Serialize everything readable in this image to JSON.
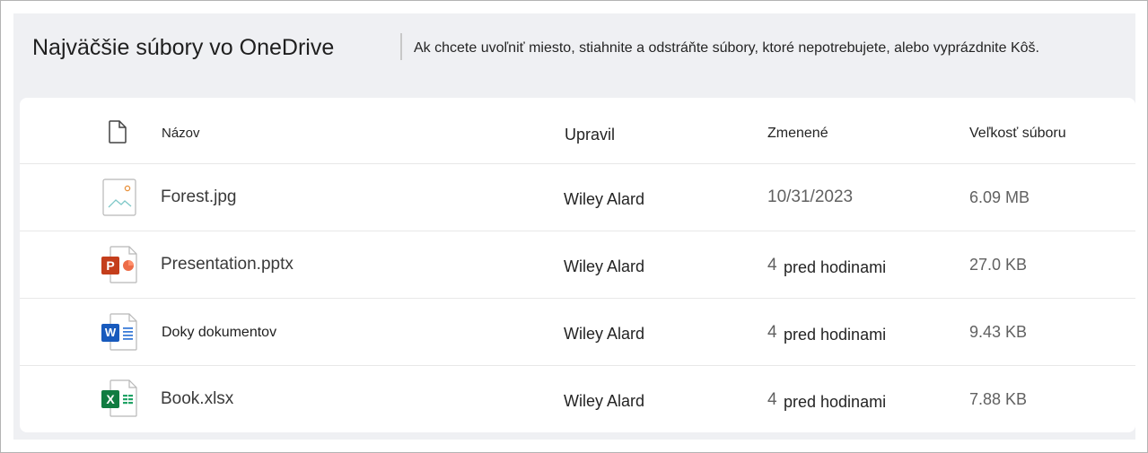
{
  "header": {
    "title": "Najväčšie súbory vo OneDrive",
    "description": "Ak chcete uvoľniť miesto, stiahnite a odstráňte súbory, ktoré nepotrebujete, alebo vyprázdnite Kôš."
  },
  "table": {
    "columns": {
      "name": "Názov",
      "modified_by": "Upravil",
      "modified": "Zmenené",
      "size": "Veľkosť súboru"
    },
    "rows": [
      {
        "icon": "image-file-icon",
        "name": "Forest.jpg",
        "modified_by": "Wiley Alard",
        "modified": "10/31/2023",
        "size": "6.09 MB"
      },
      {
        "icon": "powerpoint-file-icon",
        "badge": "P",
        "name": "Presentation.pptx",
        "modified_by": "Wiley Alard",
        "modified_num": "4",
        "modified_text": "pred hodinami",
        "size": "27.0 KB"
      },
      {
        "icon": "word-file-icon",
        "badge": "W",
        "name": "Doky dokumentov",
        "modified_by": "Wiley Alard",
        "modified_num": "4",
        "modified_text": "pred hodinami",
        "size": "9.43 KB"
      },
      {
        "icon": "excel-file-icon",
        "badge": "X",
        "name": "Book.xlsx",
        "modified_by": "Wiley Alard",
        "modified_num": "4",
        "modified_text": "pred hodinami",
        "size": "7.88 KB"
      }
    ]
  },
  "colors": {
    "powerpoint": "#c43e1c",
    "word": "#185abd",
    "excel": "#107c41",
    "panel_bg": "#eff0f3"
  }
}
